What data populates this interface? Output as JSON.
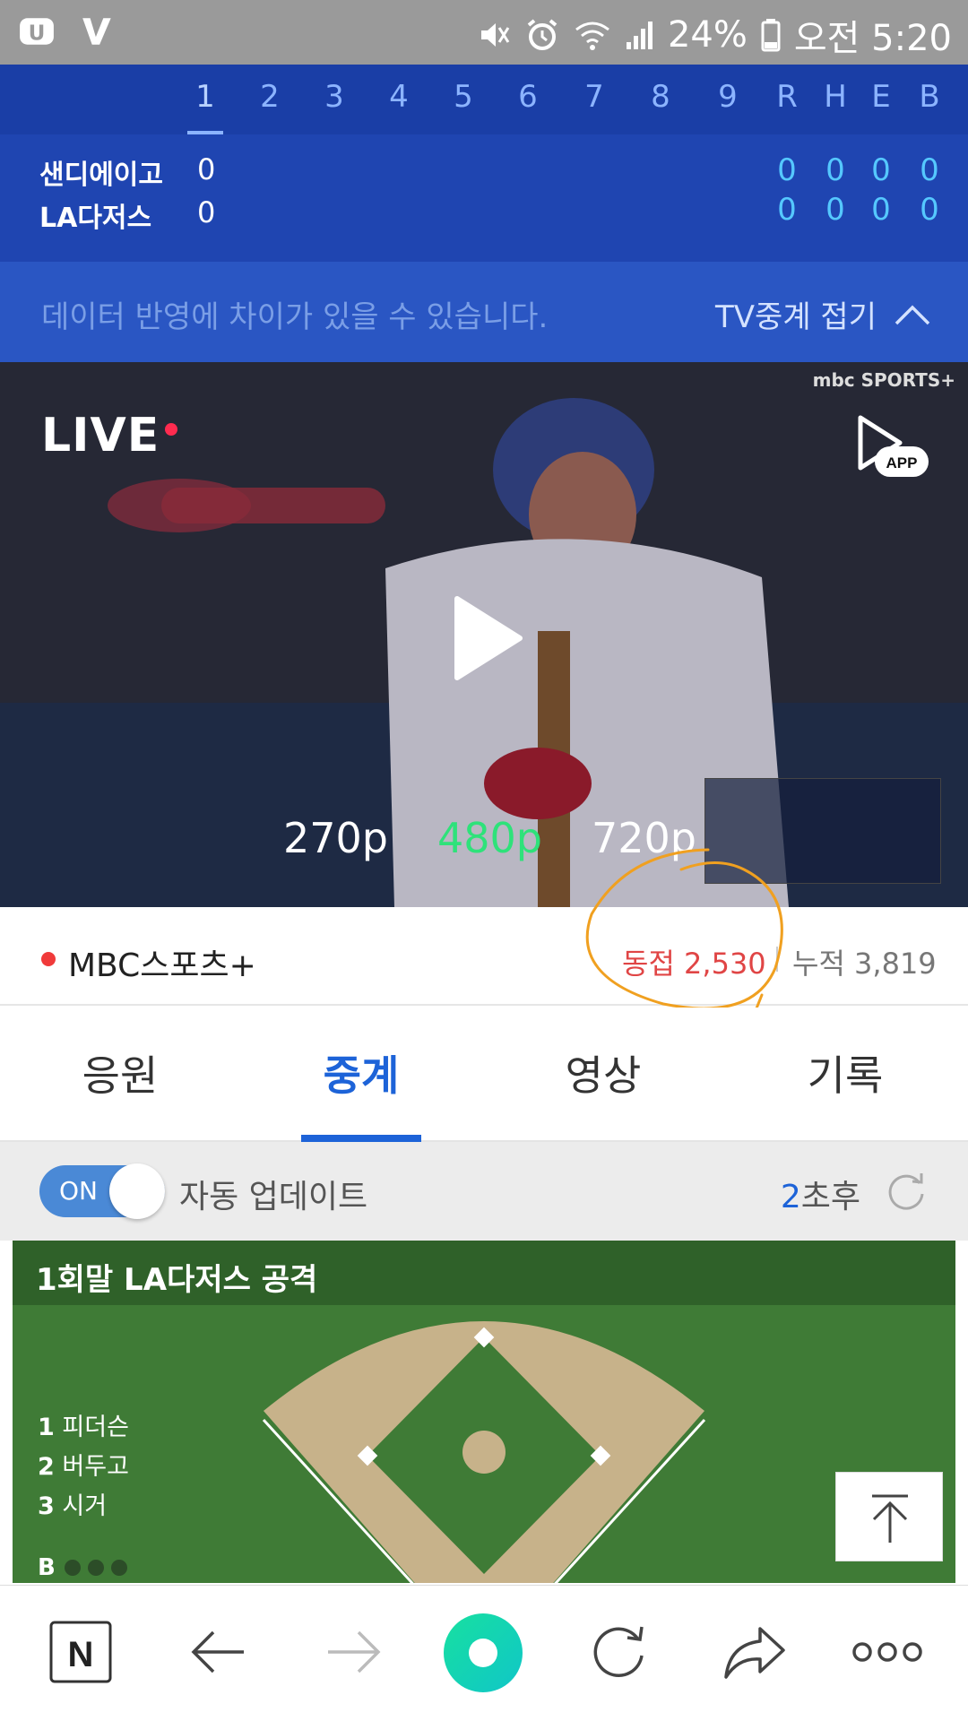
{
  "status_bar": {
    "battery": "24%",
    "time": "오전 5:20",
    "left_icons": [
      "u-plus-icon",
      "v3-icon"
    ],
    "right_icons": [
      "mute-icon",
      "alarm-icon",
      "wifi-icon",
      "signal-icon",
      "battery-icon"
    ]
  },
  "scoreboard": {
    "innings": [
      "1",
      "2",
      "3",
      "4",
      "5",
      "6",
      "7",
      "8",
      "9"
    ],
    "active_inning": "1",
    "totals_headers": [
      "R",
      "H",
      "E",
      "B"
    ],
    "teams": [
      {
        "name": "샌디에이고",
        "inning_1": "0",
        "totals": [
          "0",
          "0",
          "0",
          "0"
        ]
      },
      {
        "name": "LA다저스",
        "inning_1": "0",
        "totals": [
          "0",
          "0",
          "0",
          "0"
        ]
      }
    ],
    "note": "데이터 반영에 차이가 있을 수 있습니다.",
    "tv_fold_label": "TV중계 접기"
  },
  "video": {
    "live_label": "LIVE",
    "broadcaster_logo": "mbc SPORTS+",
    "app_label": "APP",
    "qualities": [
      "270p",
      "480p",
      "720p"
    ],
    "selected_quality": "480p"
  },
  "channel": {
    "name": "MBC스포츠+",
    "concurrent": "동접 2,530",
    "cumulative": "누적 3,819"
  },
  "tabs": {
    "items": [
      "응원",
      "중계",
      "영상",
      "기록"
    ],
    "active": "중계"
  },
  "auto_update": {
    "toggle_label": "ON",
    "label": "자동 업데이트",
    "countdown_num": "2",
    "countdown_unit": "초후"
  },
  "field": {
    "title": "1회말 LA다저스 공격",
    "lineup": [
      {
        "num": "1",
        "name": "피더슨"
      },
      {
        "num": "2",
        "name": "버두고"
      },
      {
        "num": "3",
        "name": "시거"
      }
    ],
    "balls_label": "B"
  },
  "bottom_nav": {
    "home_label": "N"
  },
  "colors": {
    "accent": "#1d63d8",
    "scoreboard_bg": "#1f45b1",
    "live_dot": "#ff2b4f",
    "selected_quality": "#2ee27a",
    "concurrent_red": "#e04545",
    "annotation_orange": "#f0a020"
  }
}
